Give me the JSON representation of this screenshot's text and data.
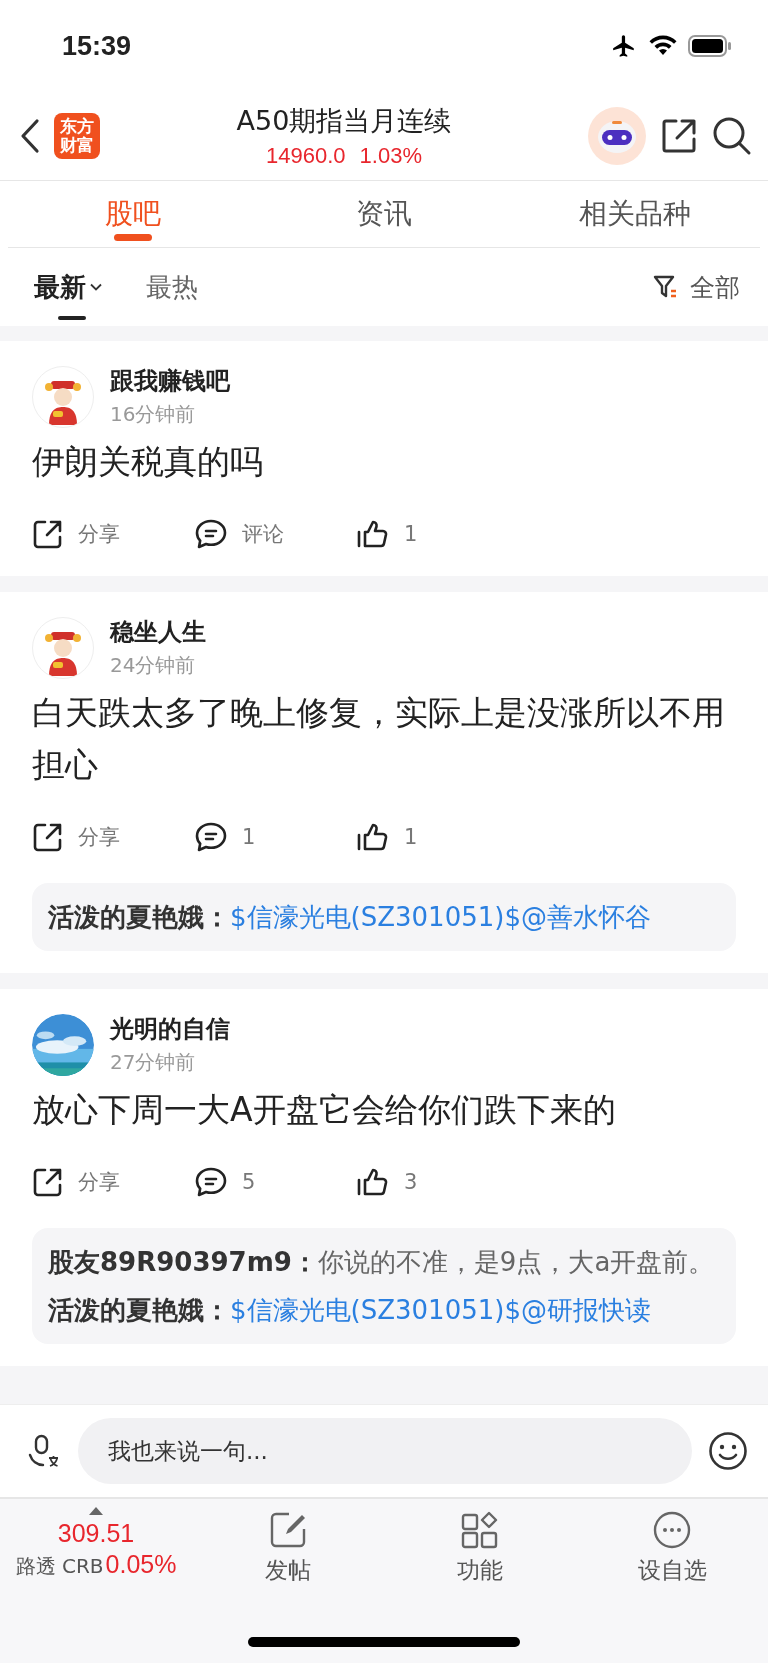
{
  "status_bar": {
    "time": "15:39"
  },
  "header": {
    "logo_lines": [
      "东方",
      "财富"
    ],
    "title": "A50期指当月连续",
    "price": "14960.0",
    "change": "1.03%"
  },
  "tabs": [
    {
      "label": "股吧",
      "selected": true
    },
    {
      "label": "资讯",
      "selected": false
    },
    {
      "label": "相关品种",
      "selected": false
    }
  ],
  "sort_options": [
    {
      "label": "最新",
      "selected": true
    },
    {
      "label": "最热",
      "selected": false
    }
  ],
  "filter": {
    "label": "全部"
  },
  "posts": [
    {
      "avatar": {
        "kind": "figure"
      },
      "author": "跟我赚钱吧",
      "time": "16分钟前",
      "content": "伊朗关税真的吗",
      "actions": [
        {
          "kind": "share",
          "label": "分享"
        },
        {
          "kind": "comment",
          "label": "评论"
        },
        {
          "kind": "like",
          "label": "1"
        }
      ]
    },
    {
      "avatar": {
        "kind": "figure"
      },
      "author": "稳坐人生",
      "time": "24分钟前",
      "content": "白天跌太多了晚上修复，实际上是没涨所以不用担心",
      "actions": [
        {
          "kind": "share",
          "label": "分享"
        },
        {
          "kind": "comment",
          "label": "1"
        },
        {
          "kind": "like",
          "label": "1"
        }
      ],
      "replies": [
        {
          "author": "活泼的夏艳娥：",
          "kind": "link",
          "text": "$信濠光电(SZ301051)$@善水怀谷"
        }
      ]
    },
    {
      "avatar": {
        "kind": "picture"
      },
      "author": "光明的自信",
      "time": "27分钟前",
      "content": "放心下周一大A开盘它会给你们跌下来的",
      "actions": [
        {
          "kind": "share",
          "label": "分享"
        },
        {
          "kind": "comment",
          "label": "5"
        },
        {
          "kind": "like",
          "label": "3"
        }
      ],
      "replies": [
        {
          "author": "股友89R90397m9：",
          "kind": "plain",
          "text": "你说的不准，是9点，大a开盘前。"
        },
        {
          "author": "活泼的夏艳娥：",
          "kind": "link",
          "text": "$信濠光电(SZ301051)$@研报快读"
        }
      ]
    }
  ],
  "comment_bar": {
    "placeholder": "我也来说一句..."
  },
  "bottom_nav": [
    {
      "kind": "ticker",
      "value": "309.51",
      "label": "路透 CRB",
      "change": "0.05%"
    },
    {
      "kind": "post",
      "label": "发帖"
    },
    {
      "kind": "apps",
      "label": "功能"
    },
    {
      "kind": "more",
      "label": "设自选"
    }
  ]
}
